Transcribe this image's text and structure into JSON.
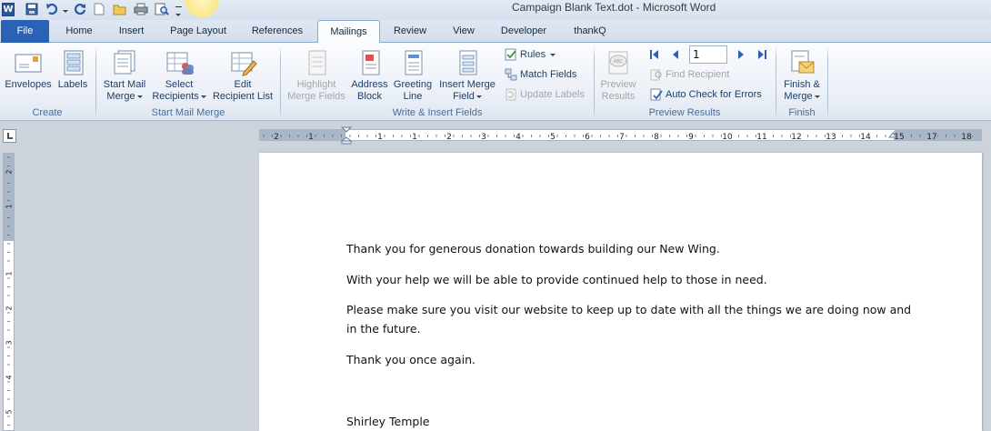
{
  "window": {
    "title": "Campaign Blank Text.dot  -  Microsoft Word"
  },
  "tabs": [
    "File",
    "Home",
    "Insert",
    "Page Layout",
    "References",
    "Mailings",
    "Review",
    "View",
    "Developer",
    "thankQ"
  ],
  "ribbon": {
    "create": {
      "label": "Create",
      "envelopes": "Envelopes",
      "labels": "Labels"
    },
    "start": {
      "label": "Start Mail Merge",
      "start_line1": "Start Mail",
      "start_line2": "Merge",
      "select_line1": "Select",
      "select_line2": "Recipients",
      "edit_line1": "Edit",
      "edit_line2": "Recipient List"
    },
    "write": {
      "label": "Write & Insert Fields",
      "highlight_line1": "Highlight",
      "highlight_line2": "Merge Fields",
      "address_line1": "Address",
      "address_line2": "Block",
      "greeting_line1": "Greeting",
      "greeting_line2": "Line",
      "insert_line1": "Insert Merge",
      "insert_line2": "Field",
      "rules": "Rules",
      "match": "Match Fields",
      "update": "Update Labels"
    },
    "preview": {
      "label": "Preview Results",
      "preview_line1": "Preview",
      "preview_line2": "Results",
      "record": "1",
      "find": "Find Recipient",
      "auto": "Auto Check for Errors"
    },
    "finish": {
      "label": "Finish",
      "finish_line1": "Finish &",
      "finish_line2": "Merge"
    }
  },
  "ruler": {
    "ticks": [
      "2",
      "1",
      "1",
      "1",
      "2",
      "3",
      "4",
      "5",
      "6",
      "7",
      "8",
      "9",
      "10",
      "11",
      "12",
      "13",
      "14",
      "15",
      "17",
      "18"
    ],
    "vticks": [
      "2",
      "1",
      "1",
      "2",
      "3",
      "4",
      "5"
    ]
  },
  "document": {
    "p1": "Thank you for generous donation towards building our New Wing.",
    "p2": "With your help we will be able to provide continued help to those in need.",
    "p3a": "Please make sure you visit our website to keep up to date with all the things we are doing now and",
    "p3b": "in the future.",
    "p4": "Thank you once again.",
    "signature": "Shirley Temple"
  }
}
